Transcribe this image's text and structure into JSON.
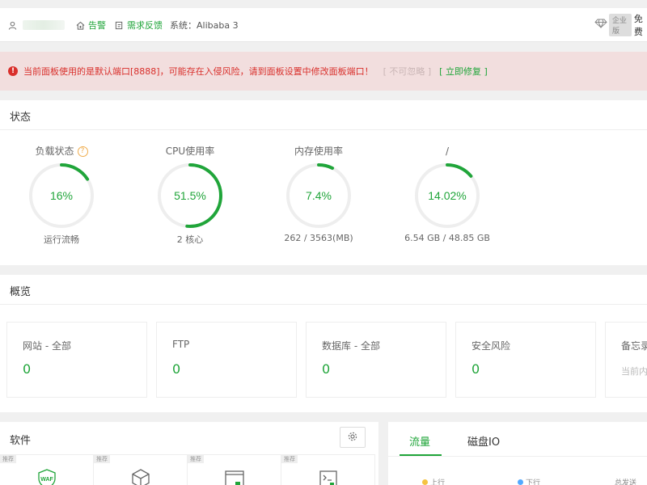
{
  "topbar": {
    "user_icon": "user-icon",
    "alarm_label": "告警",
    "alarm_icon": "home-alert-icon",
    "feedback_label": "需求反馈",
    "feedback_icon": "edit-icon",
    "system_label": "系统：Alibaba 3",
    "enterprise_icon": "diamond-icon",
    "enterprise_tag": "企业版",
    "free_label": "免费"
  },
  "warning": {
    "icon": "alert-icon",
    "text": "当前面板使用的是默认端口[8888]，可能存在入侵风险，请到面板设置中修改面板端口！",
    "ignore_label": "[ 不可忽略 ]",
    "fix_label": "[ 立即修复 ]"
  },
  "status": {
    "title": "状态",
    "help_icon": "question-icon",
    "gauges": [
      {
        "label": "负载状态",
        "value_text": "16%",
        "percent": 16,
        "sub": "运行流畅"
      },
      {
        "label": "CPU使用率",
        "value_text": "51.5%",
        "percent": 51.5,
        "sub": "2 核心"
      },
      {
        "label": "内存使用率",
        "value_text": "7.4%",
        "percent": 7.4,
        "sub": "262 / 3563(MB)"
      },
      {
        "label": "/",
        "value_text": "14.02%",
        "percent": 14.02,
        "sub": "6.54 GB / 48.85 GB"
      }
    ],
    "colors": {
      "accent": "#20a53a",
      "track": "#eeeeee"
    }
  },
  "overview": {
    "title": "概览",
    "cards": [
      {
        "label": "网站 - 全部",
        "value": "0"
      },
      {
        "label": "FTP",
        "value": "0"
      },
      {
        "label": "数据库 - 全部",
        "value": "0"
      },
      {
        "label": "安全风险",
        "value": "0"
      },
      {
        "label": "备忘录",
        "sub": "当前内容"
      }
    ]
  },
  "software": {
    "title": "软件",
    "settings_icon": "gear-icon",
    "items": [
      {
        "badge": "推荐",
        "icon": "waf-shield-icon"
      },
      {
        "badge": "推荐",
        "icon": "cube-icon"
      },
      {
        "badge": "推荐",
        "icon": "browser-lock-icon"
      },
      {
        "badge": "推荐",
        "icon": "terminal-icon"
      }
    ]
  },
  "traffic": {
    "tabs": [
      {
        "label": "流量",
        "active": true
      },
      {
        "label": "磁盘IO",
        "active": false
      }
    ],
    "legend": [
      {
        "label": "上行",
        "color": "#f5c342"
      },
      {
        "label": "下行",
        "color": "#52a9ff"
      },
      {
        "label": "总发送"
      }
    ]
  }
}
